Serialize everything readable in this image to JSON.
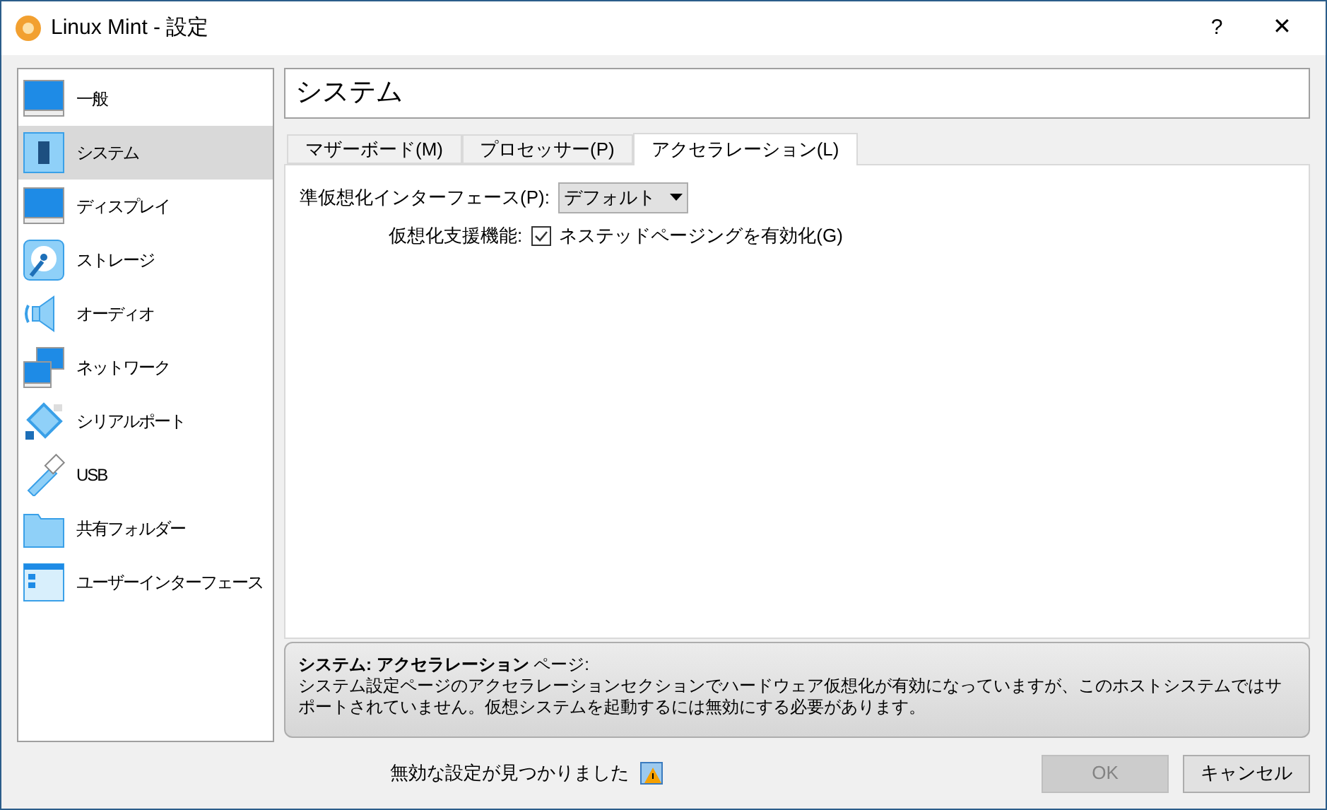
{
  "window": {
    "title": "Linux Mint - 設定",
    "help": "?",
    "close": "✕"
  },
  "sidebar": {
    "items": [
      {
        "label": "一般",
        "kind": "general",
        "selected": false
      },
      {
        "label": "システム",
        "kind": "system",
        "selected": true
      },
      {
        "label": "ディスプレイ",
        "kind": "display",
        "selected": false
      },
      {
        "label": "ストレージ",
        "kind": "storage",
        "selected": false
      },
      {
        "label": "オーディオ",
        "kind": "audio",
        "selected": false
      },
      {
        "label": "ネットワーク",
        "kind": "network",
        "selected": false
      },
      {
        "label": "シリアルポート",
        "kind": "serial",
        "selected": false
      },
      {
        "label": "USB",
        "kind": "usb",
        "selected": false
      },
      {
        "label": "共有フォルダー",
        "kind": "folder",
        "selected": false
      },
      {
        "label": "ユーザーインターフェース",
        "kind": "ui",
        "selected": false
      }
    ]
  },
  "page_title": "システム",
  "tabs": [
    {
      "label": "マザーボード(M)",
      "selected": false
    },
    {
      "label": "プロセッサー(P)",
      "selected": false
    },
    {
      "label": "アクセラレーション(L)",
      "selected": true
    }
  ],
  "paravirt": {
    "label": "準仮想化インターフェース(P):",
    "value": "デフォルト"
  },
  "hw_virt": {
    "label": "仮想化支援機能:",
    "option": "ネステッドページングを有効化(G)",
    "checked": true
  },
  "message": {
    "title": "**システム: アクセラレーション** ページ:",
    "text": "システム設定ページのアクセラレーションセクションでハードウェア仮想化が有効になっていますが、このホストシステムではサポートされていません。仮想システムを起動するには無効にする必要があります。"
  },
  "status": {
    "text": "無効な設定が見つかりました"
  },
  "buttons": [
    {
      "label": "OK",
      "disabled": true
    },
    {
      "label": "キャンセル",
      "disabled": false
    }
  ]
}
